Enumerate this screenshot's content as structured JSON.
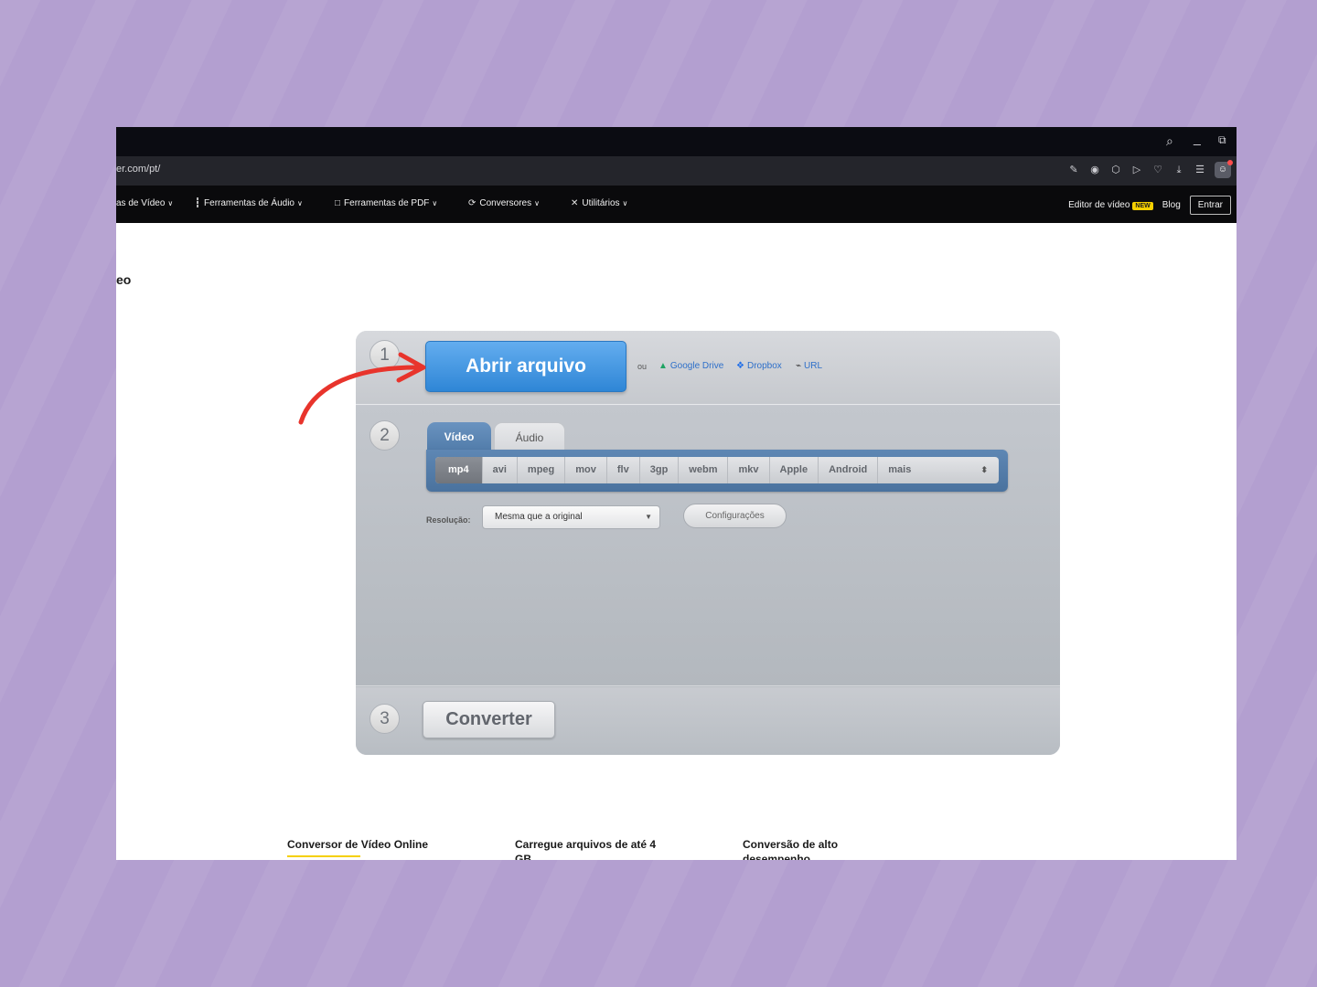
{
  "browser": {
    "url_fragment": "er.com/pt/",
    "window_controls": [
      "search-icon",
      "minimize-icon",
      "restore-icon"
    ],
    "toolbar_icons": [
      "edit-icon",
      "camera-icon",
      "shield-icon",
      "play-icon",
      "heart-icon",
      "download-icon",
      "menu-icon",
      "profile-icon"
    ]
  },
  "nav": {
    "items": [
      {
        "label": "as de Vídeo",
        "icon": ""
      },
      {
        "label": "Ferramentas de Áudio",
        "icon": "audio-wave-icon"
      },
      {
        "label": "Ferramentas de PDF",
        "icon": "pdf-icon"
      },
      {
        "label": "Conversores",
        "icon": "convert-icon"
      },
      {
        "label": "Utilitários",
        "icon": "tools-icon"
      }
    ],
    "editor_label": "Editor de vídeo",
    "new_badge": "NEW",
    "blog_label": "Blog",
    "enter_label": "Entrar"
  },
  "page": {
    "heading_fragment": "eo"
  },
  "converter": {
    "steps": [
      "1",
      "2",
      "3"
    ],
    "open_file_label": "Abrir arquivo",
    "or_label": "ou",
    "sources": [
      {
        "label": "Google Drive",
        "icon": "google-drive-icon"
      },
      {
        "label": "Dropbox",
        "icon": "dropbox-icon"
      },
      {
        "label": "URL",
        "icon": "link-icon"
      }
    ],
    "tabs": [
      {
        "label": "Vídeo",
        "active": true
      },
      {
        "label": "Áudio",
        "active": false
      }
    ],
    "formats": [
      "mp4",
      "avi",
      "mpeg",
      "mov",
      "flv",
      "3gp",
      "webm",
      "mkv",
      "Apple",
      "Android",
      "mais"
    ],
    "active_format": "mp4",
    "resolution_label": "Resolução:",
    "resolution_value": "Mesma que a original",
    "config_label": "Configurações",
    "convert_label": "Converter"
  },
  "features": [
    "Conversor de Vídeo Online",
    "Carregue arquivos de até 4 GB",
    "Conversão de alto desempenho"
  ],
  "colors": {
    "background": "#b39fd0",
    "primary_button": "#3d92e0",
    "annotation_arrow": "#e8342c",
    "accent_yellow": "#f5d000"
  }
}
